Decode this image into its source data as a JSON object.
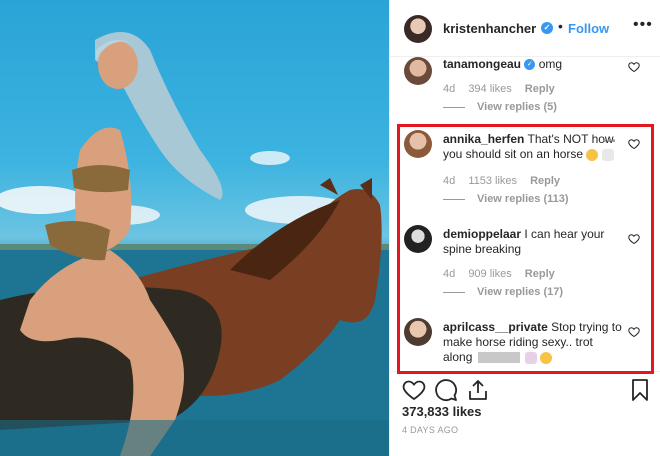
{
  "header": {
    "username": "kristenhancher",
    "separator": "•",
    "follow_label": "Follow",
    "more_label": "•••"
  },
  "comments": [
    {
      "username": "tanamongeau",
      "verified": true,
      "text": "omg",
      "age": "4d",
      "likes": "394 likes",
      "reply_label": "Reply",
      "view_replies": "View replies (5)"
    },
    {
      "username": "annika_herfen",
      "text_line1": "That's NOT how",
      "text_line2": "you should sit on an horse",
      "more": "•••",
      "age": "4d",
      "likes": "1153 likes",
      "reply_label": "Reply",
      "view_replies": "View replies (113)"
    },
    {
      "username": "demioppelaar",
      "text_line1": "I can hear your",
      "text_line2": "spine breaking",
      "age": "4d",
      "likes": "909 likes",
      "reply_label": "Reply",
      "view_replies": "View replies (17)"
    },
    {
      "username": "aprilcass__private",
      "text_line1": "Stop trying to",
      "text_line2": "make horse riding sexy.. trot",
      "text_line3": "along"
    }
  ],
  "footer": {
    "likes": "373,833 likes",
    "date": "4 DAYS AGO"
  },
  "colors": {
    "accent": "#3897f0",
    "highlight": "#e3181f",
    "muted": "#999999"
  }
}
